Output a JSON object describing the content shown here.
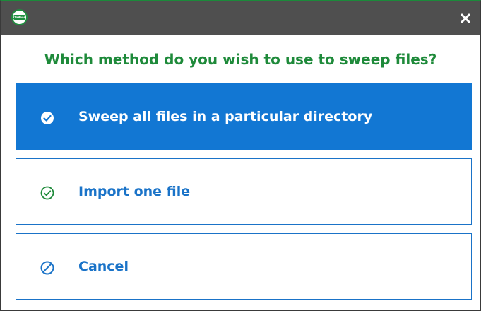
{
  "window": {
    "logo_text": "OnBase",
    "close_glyph": "✕",
    "accent_color": "#1277d3",
    "title_color": "#1e8a3a"
  },
  "question": "Which method do you wish to use to sweep files?",
  "options": [
    {
      "label": "Sweep all files in a particular directory",
      "icon": "check-circle-icon",
      "selected": true
    },
    {
      "label": "Import one file",
      "icon": "check-circle-icon",
      "selected": false
    },
    {
      "label": "Cancel",
      "icon": "cancel-icon",
      "selected": false
    }
  ]
}
